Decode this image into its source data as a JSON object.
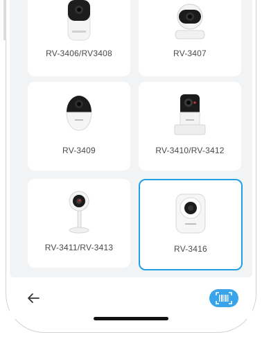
{
  "devices": [
    {
      "label": "RV-3406/RV3408",
      "icon": "camera-tall-icon"
    },
    {
      "label": "RV-3407",
      "icon": "camera-pan-tilt-icon"
    },
    {
      "label": "RV-3409",
      "icon": "camera-dome-icon"
    },
    {
      "label": "RV-3410/RV-3412",
      "icon": "camera-cube-icon"
    },
    {
      "label": "RV-3411/RV-3413",
      "icon": "camera-stick-icon"
    },
    {
      "label": "RV-3416",
      "icon": "camera-pan-tilt-white-icon",
      "selected": true
    }
  ],
  "nav": {
    "back_icon": "arrow-left-icon",
    "scan_icon": "barcode-scan-icon"
  },
  "colors": {
    "accent": "#1ea0e6",
    "scan_button": "#3aa4ea",
    "screen_bg": "#f2f3f5"
  }
}
